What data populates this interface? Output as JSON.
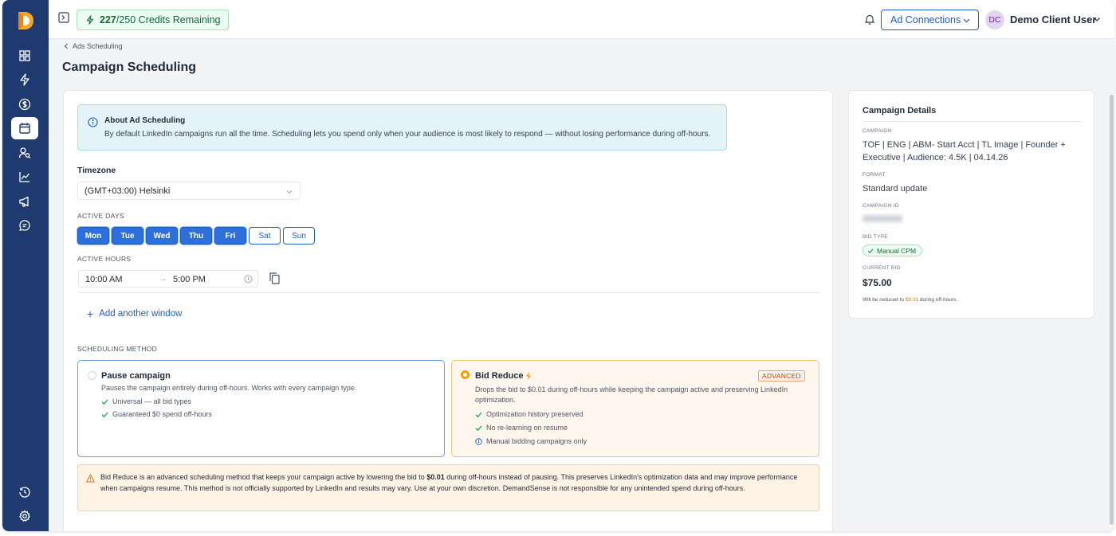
{
  "topbar": {
    "credits_used": "227",
    "credits_rest": "/250 Credits Remaining",
    "ad_connections_label": "Ad Connections",
    "user_initials": "DC",
    "user_name": "Demo Client User"
  },
  "breadcrumb": {
    "back_label": "Ads Scheduling"
  },
  "page_title": "Campaign Scheduling",
  "about": {
    "title": "About Ad Scheduling",
    "text": "By default LinkedIn campaigns run all the time. Scheduling lets you spend only when your audience is most likely to respond — without losing performance during off-hours."
  },
  "timezone": {
    "label": "Timezone",
    "value": "(GMT+03:00) Helsinki"
  },
  "active_days": {
    "label": "ACTIVE DAYS",
    "days": [
      {
        "label": "Mon",
        "active": true
      },
      {
        "label": "Tue",
        "active": true
      },
      {
        "label": "Wed",
        "active": true
      },
      {
        "label": "Thu",
        "active": true
      },
      {
        "label": "Fri",
        "active": true
      },
      {
        "label": "Sat",
        "active": false
      },
      {
        "label": "Sun",
        "active": false
      }
    ]
  },
  "active_hours": {
    "label": "ACTIVE HOURS",
    "from": "10:00 AM",
    "arrow": "→",
    "to": "5:00 PM"
  },
  "add_window_label": "Add another window",
  "scheduling_method": {
    "label": "SCHEDULING METHOD",
    "pause": {
      "title": "Pause campaign",
      "desc": "Pauses the campaign entirely during off-hours. Works with every campaign type.",
      "features": [
        "Universal — all bid types",
        "Guaranteed $0 spend off-hours"
      ]
    },
    "bid_reduce": {
      "title": "Bid Reduce",
      "badge": "ADVANCED",
      "desc": "Drops the bid to $0.01 during off-hours while keeping the campaign active and preserving LinkedIn optimization.",
      "features": [
        "Optimization history preserved",
        "No re-learning on resume",
        "Manual bidding campaigns only"
      ]
    }
  },
  "warning": {
    "pre": "Bid Reduce is an advanced scheduling method that keeps your campaign active by lowering the bid to ",
    "bold": "$0.01",
    "post": " during off-hours instead of pausing. This preserves LinkedIn's optimization data and may improve performance when campaigns resume. This method is not officially supported by LinkedIn and results may vary. Use at your own discretion. DemandSense is not responsible for any unintended spend during off-hours."
  },
  "details": {
    "title": "Campaign Details",
    "campaign_label": "CAMPAIGN",
    "campaign_value": "TOF | ENG | ABM- Start Acct | TL Image | Founder + Executive | Audience: 4.5K | 04.14.26",
    "format_label": "FORMAT",
    "format_value": "Standard update",
    "campaign_id_label": "CAMPAIGN ID",
    "bid_type_label": "BID TYPE",
    "bid_type_value": "Manual CPM",
    "current_bid_label": "CURRENT BID",
    "current_bid_value": "$75.00",
    "note_pre": "Will be reduced to ",
    "note_hl": "$0.01",
    "note_post": " during off-hours."
  },
  "colors": {
    "sidebar": "#1e3a6e",
    "accent": "#2e6fde",
    "success": "#166534",
    "warning": "#f59e0b"
  }
}
